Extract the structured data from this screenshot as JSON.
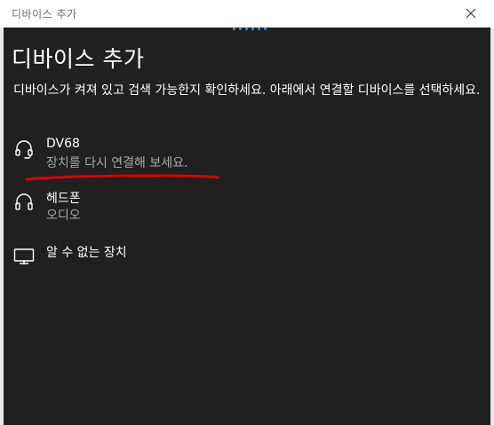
{
  "window": {
    "title": "디바이스 추가"
  },
  "heading": "디바이스 추가",
  "description": "디바이스가 켜져 있고 검색 가능한지 확인하세요. 아래에서 연결할 디바이스를 선택하세요.",
  "devices": [
    {
      "name": "DV68",
      "status": "장치를 다시 연결해 보세요.",
      "icon": "headset-icon"
    },
    {
      "name": "헤드폰",
      "status": "오디오",
      "icon": "headphones-icon"
    },
    {
      "name": "알 수 없는 장치",
      "status": "",
      "icon": "monitor-icon"
    }
  ],
  "colors": {
    "panel_bg": "#202020",
    "accent": "#3a8ee6",
    "secondary_text": "#a8a8a8",
    "annotation": "#e00000"
  }
}
